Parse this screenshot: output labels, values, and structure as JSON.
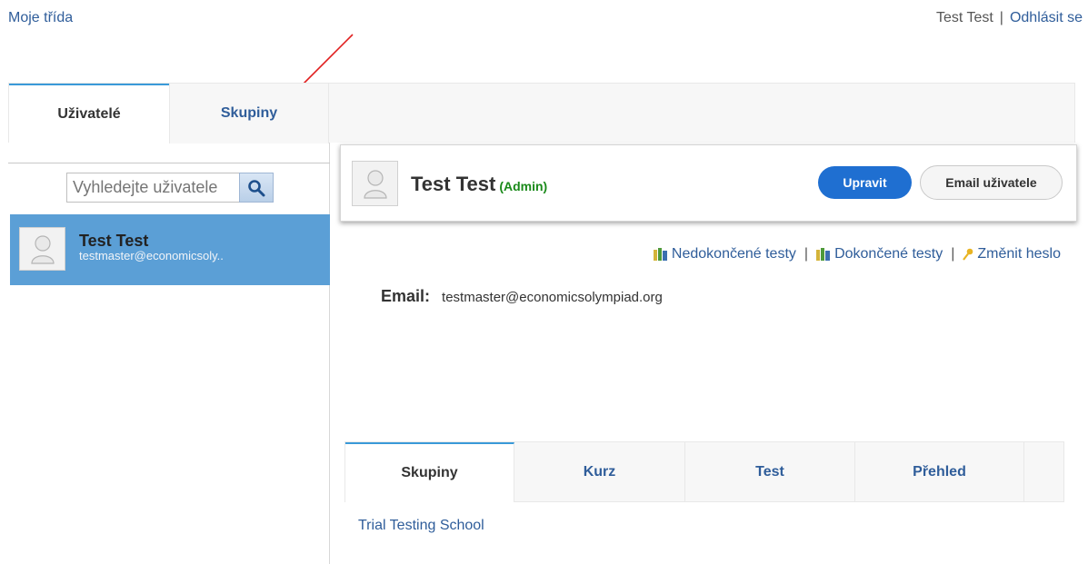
{
  "header": {
    "my_class": "Moje třída",
    "user_name": "Test Test",
    "separator": "|",
    "logout": "Odhlásit se"
  },
  "top_tabs": {
    "users": "Uživatelé",
    "groups": "Skupiny"
  },
  "search": {
    "placeholder": "Vyhledejte uživatele"
  },
  "user_list": [
    {
      "name": "Test Test",
      "email": "testmaster@economicsoly.."
    }
  ],
  "profile": {
    "name": "Test Test",
    "role": "(Admin)",
    "edit_button": "Upravit",
    "email_button": "Email uživatele",
    "links": {
      "unfinished_tests": "Nedokončené testy",
      "finished_tests": "Dokončené testy",
      "change_password": "Změnit heslo",
      "separator": "|"
    },
    "email_label": "Email:",
    "email_value": "testmaster@economicsolympiad.org"
  },
  "bottom_tabs": [
    "Skupiny",
    "Kurz",
    "Test",
    "Přehled"
  ],
  "groups": [
    "Trial Testing School"
  ],
  "colors": {
    "accent": "#1f6fd1",
    "selected_row": "#5b9fd6",
    "link": "#2f5d9a",
    "admin": "#1a8a1a",
    "annotation_arrow": "#e02020"
  }
}
